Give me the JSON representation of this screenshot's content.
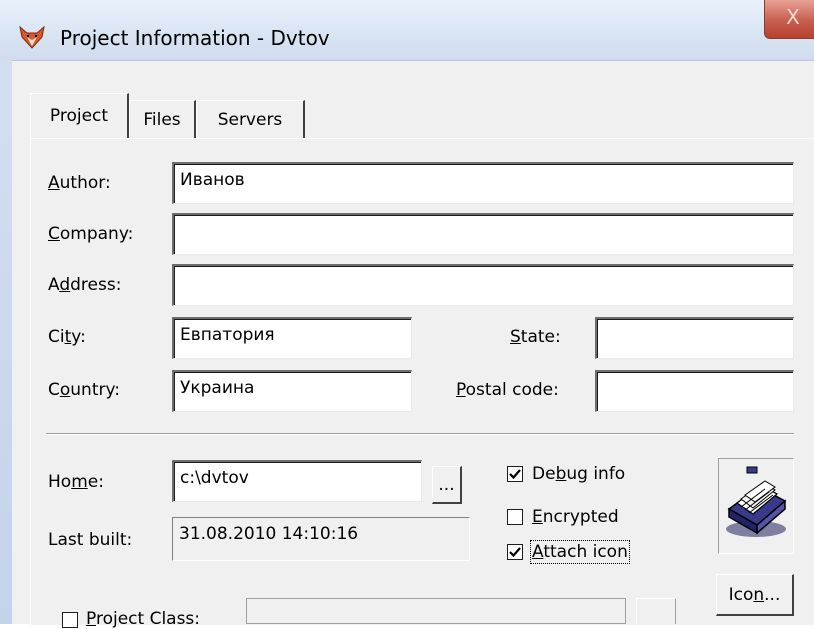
{
  "window": {
    "title": "Project Information - Dvtov",
    "close_glyph": "X",
    "icon": "fox-icon"
  },
  "tabs": [
    {
      "label": "Project",
      "active": true
    },
    {
      "label": "Files",
      "active": false
    },
    {
      "label": "Servers",
      "active": false
    }
  ],
  "form": {
    "author": {
      "label_pre": "",
      "label_key": "A",
      "label_post": "uthor:",
      "value": "Иванов"
    },
    "company": {
      "label_pre": "",
      "label_key": "C",
      "label_post": "ompany:",
      "value": ""
    },
    "address": {
      "label_pre": "A",
      "label_key": "d",
      "label_post": "dress:",
      "value": ""
    },
    "city": {
      "label_pre": "Ci",
      "label_key": "t",
      "label_post": "y:",
      "value": "Евпатория"
    },
    "state": {
      "label_pre": "",
      "label_key": "S",
      "label_post": "tate:",
      "value": ""
    },
    "country": {
      "label_pre": "C",
      "label_key": "o",
      "label_post": "untry:",
      "value": "Украина"
    },
    "postal_code": {
      "label_pre": "",
      "label_key": "P",
      "label_post": "ostal code:",
      "value": ""
    },
    "home": {
      "label_pre": "Ho",
      "label_key": "m",
      "label_post": "e:",
      "value": "c:\\dvtov",
      "browse_label": "..."
    },
    "last_built": {
      "label": "Last built:",
      "value": "31.08.2010 14:10:16"
    },
    "project_class": {
      "label_pre": "",
      "label_key": "P",
      "label_post": "roject Class:",
      "checked": false,
      "value": ""
    }
  },
  "options": {
    "debug_info": {
      "label_pre": "De",
      "label_key": "b",
      "label_post": "ug info",
      "checked": true
    },
    "encrypted": {
      "label_pre": "",
      "label_key": "E",
      "label_post": "ncrypted",
      "checked": false
    },
    "attach_icon": {
      "label_pre": "",
      "label_key": "A",
      "label_post": "ttach icon",
      "checked": true
    }
  },
  "icon_button": {
    "label_pre": "Ico",
    "label_key": "n",
    "label_post": "...",
    "preview_icon": "card-file-icon"
  },
  "colors": {
    "accent": "#6f8fc4",
    "close": "#c75e4e",
    "dialog_bg": "#f0f0f0"
  }
}
